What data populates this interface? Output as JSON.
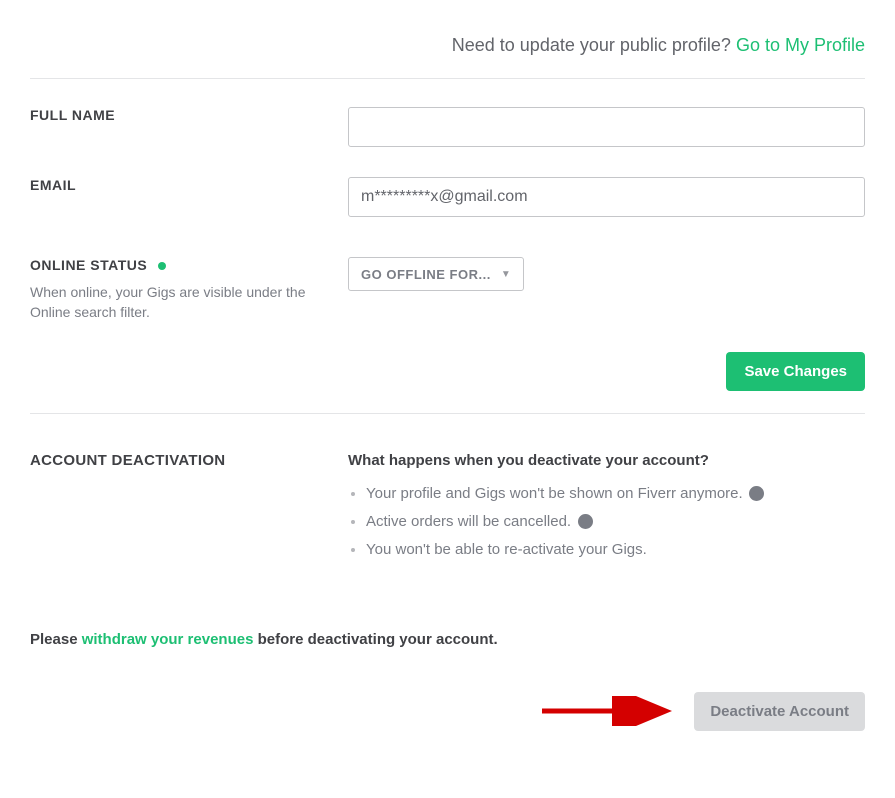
{
  "header": {
    "prompt": "Need to update your public profile?",
    "link": "Go to My Profile"
  },
  "fields": {
    "fullName": {
      "label": "FULL NAME",
      "value": ""
    },
    "email": {
      "label": "EMAIL",
      "value": "m*********x@gmail.com"
    },
    "onlineStatus": {
      "label": "ONLINE STATUS",
      "desc": "When online, your Gigs are visible under the Online search filter.",
      "selectLabel": "GO OFFLINE FOR..."
    }
  },
  "buttons": {
    "save": "Save Changes",
    "deactivate": "Deactivate Account"
  },
  "deactivation": {
    "title": "ACCOUNT DEACTIVATION",
    "subtitle": "What happens when you deactivate your account?",
    "bullets": [
      "Your profile and Gigs won't be shown on Fiverr anymore.",
      "Active orders will be cancelled.",
      "You won't be able to re-activate your Gigs."
    ],
    "withdraw": {
      "prefix": "Please ",
      "link": "withdraw your revenues",
      "suffix": " before deactivating your account."
    }
  }
}
